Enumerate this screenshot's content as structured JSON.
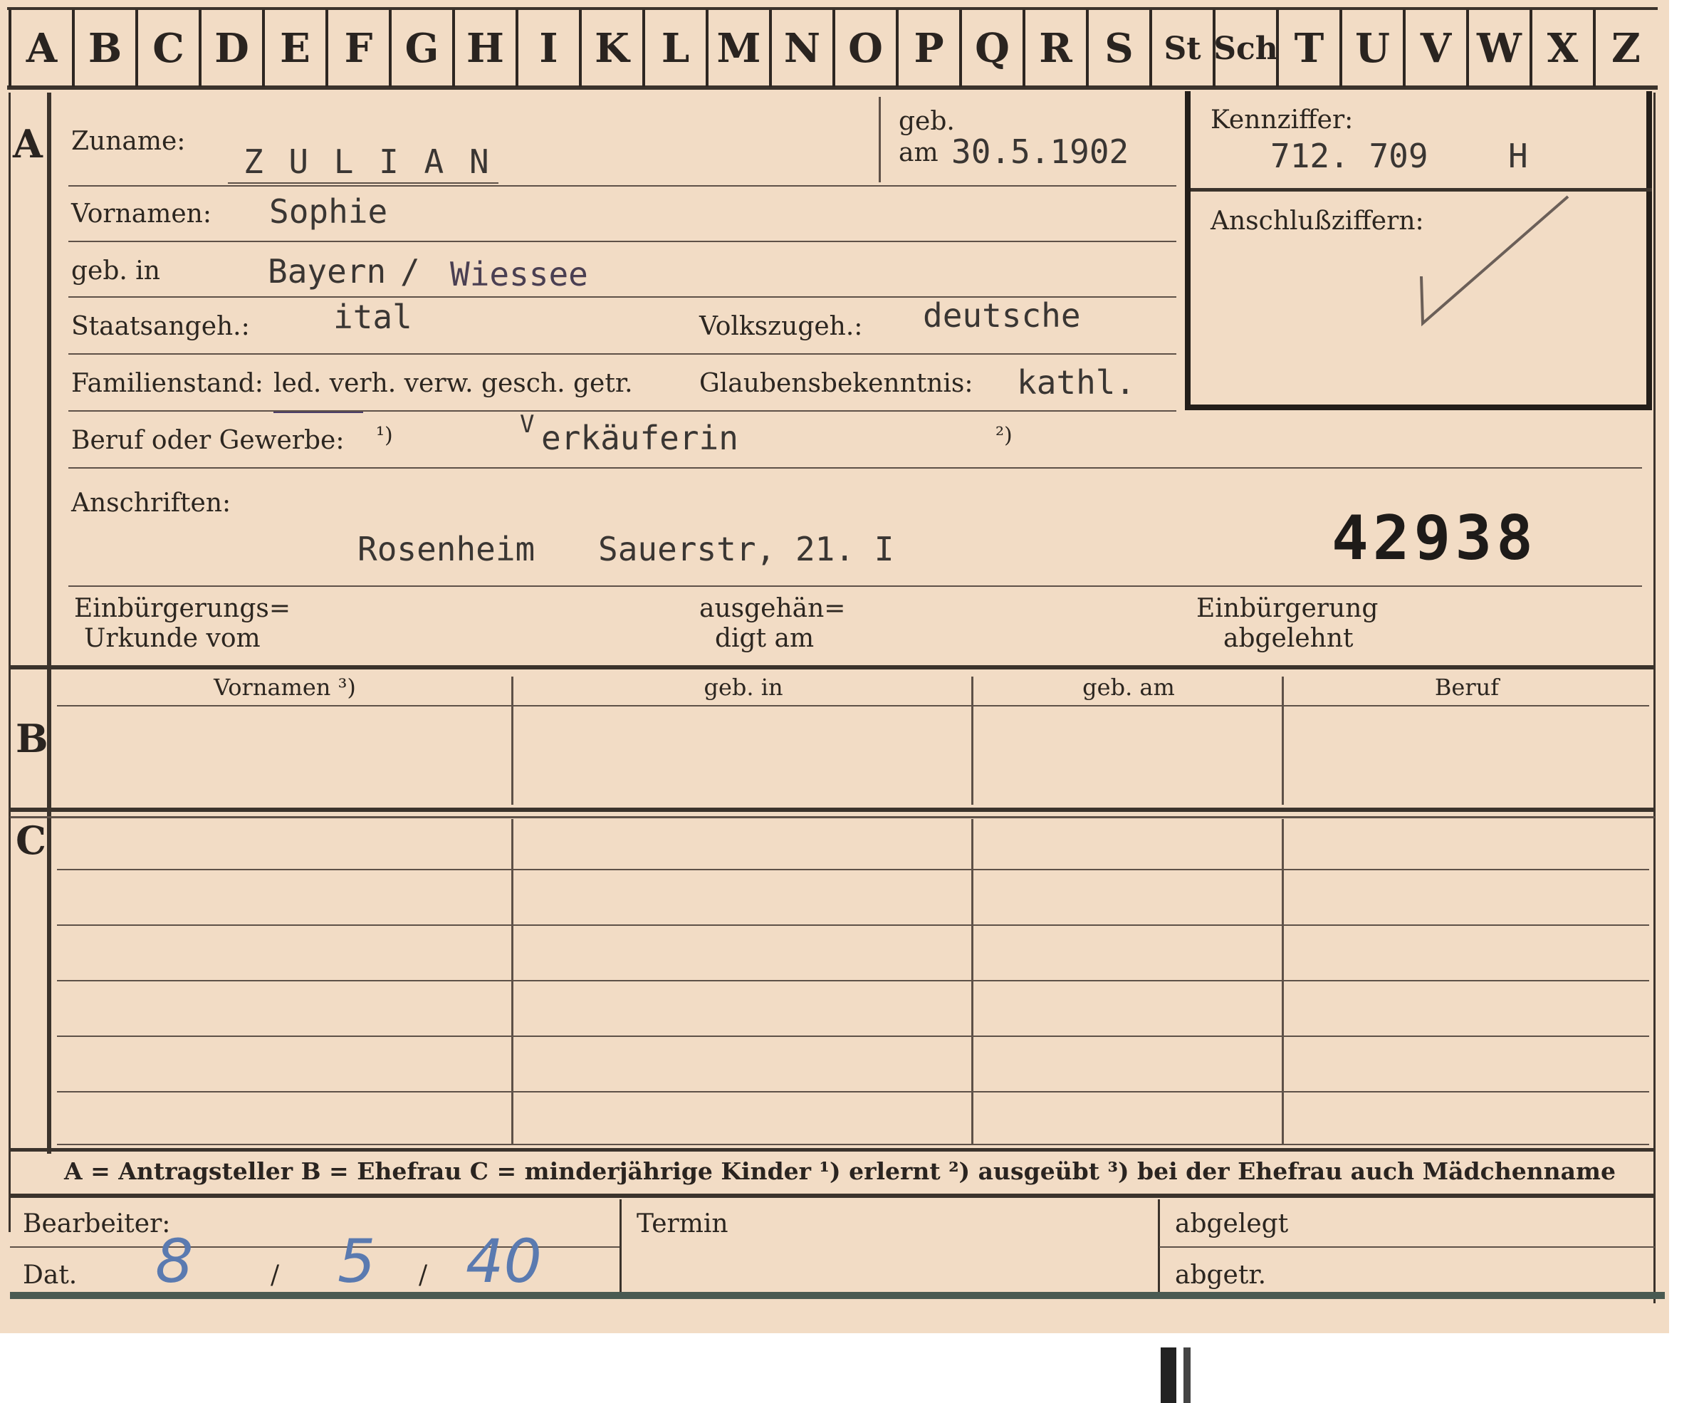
{
  "tabs": [
    "A",
    "B",
    "C",
    "D",
    "E",
    "F",
    "G",
    "H",
    "I",
    "K",
    "L",
    "M",
    "N",
    "O",
    "P",
    "Q",
    "R",
    "S",
    "St",
    "Sch",
    "T",
    "U",
    "V",
    "W",
    "X",
    "Z"
  ],
  "sections": {
    "a": "A",
    "b": "B",
    "c": "C"
  },
  "labels": {
    "zuname": "Zuname:",
    "geb": "geb.",
    "am": "am",
    "kennziffer": "Kennziffer:",
    "anschluss": "Anschlußziffern:",
    "vornamen": "Vornamen:",
    "geb_in": "geb. in",
    "staatsangeh": "Staatsangeh.:",
    "volkszugeh": "Volkszugeh.:",
    "familienstand": "Familienstand:",
    "fam_options": "led. verh. verw. gesch. getr.",
    "glaubensbekenntnis": "Glaubensbekenntnis:",
    "beruf": "Beruf oder Gewerbe:",
    "note1": "¹)",
    "note2": "²)",
    "anschriften": "Anschriften:",
    "einb_urkunde_1": "Einbürgerungs=",
    "einb_urkunde_2": "Urkunde vom",
    "ausgeh_1": "ausgehän=",
    "ausgeh_2": "digt am",
    "einb_abgelehnt_1": "Einbürgerung",
    "einb_abgelehnt_2": "abgelehnt"
  },
  "values": {
    "zuname": "Z U L I A N",
    "geb_am": "30.5.1902",
    "kennziffer": "712. 709",
    "kennziffer_suffix": "H",
    "vornamen": "Sophie",
    "geb_in_1": "Bayern",
    "geb_in_2": "Wiessee",
    "staatsangeh": "ital",
    "volkszugeh": "deutsche",
    "glaubensbekenntnis": "kathl.",
    "beruf_initial": "V",
    "beruf": "erkäuferin",
    "anschrift_city": "Rosenheim",
    "anschrift_street": "Sauerstr, 21. I",
    "number": "42938"
  },
  "table_b_headers": [
    "Vornamen ³)",
    "geb. in",
    "geb. am",
    "Beruf"
  ],
  "legend": "A = Antragsteller   B = Ehefrau   C = minderjährige Kinder   ¹) erlernt   ²) ausgeübt   ³) bei der Ehefrau auch Mädchenname",
  "footer": {
    "bearbeiter": "Bearbeiter:",
    "dat": "Dat.",
    "date_day": "8",
    "date_sep1": "/",
    "date_month": "5",
    "date_sep2": "/",
    "date_year": "40",
    "termin": "Termin",
    "abgelegt": "abgelegt",
    "abgetr": "abgetr."
  },
  "colors": {
    "card": "#f2dcc5",
    "ink": "#2a2420",
    "pencil_blue": "#5a7ab0"
  }
}
